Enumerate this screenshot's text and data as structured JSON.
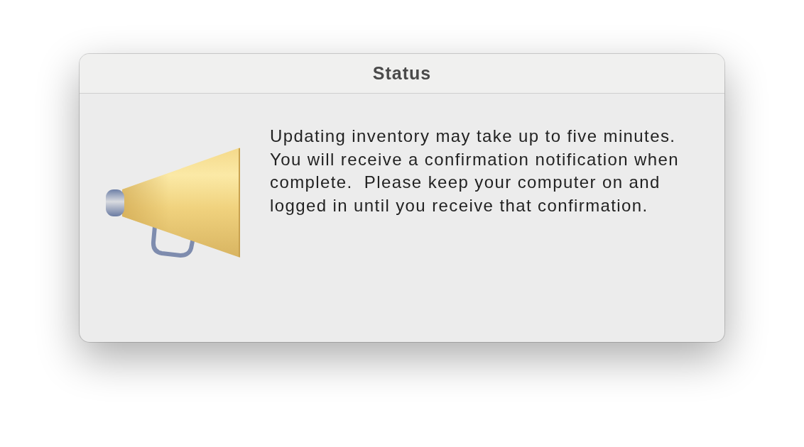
{
  "window": {
    "title": "Status"
  },
  "message": "Updating inventory may take up to five minutes. You will receive a confirmation notification when complete.  Please keep your computer on and logged in until you receive that confirmation."
}
